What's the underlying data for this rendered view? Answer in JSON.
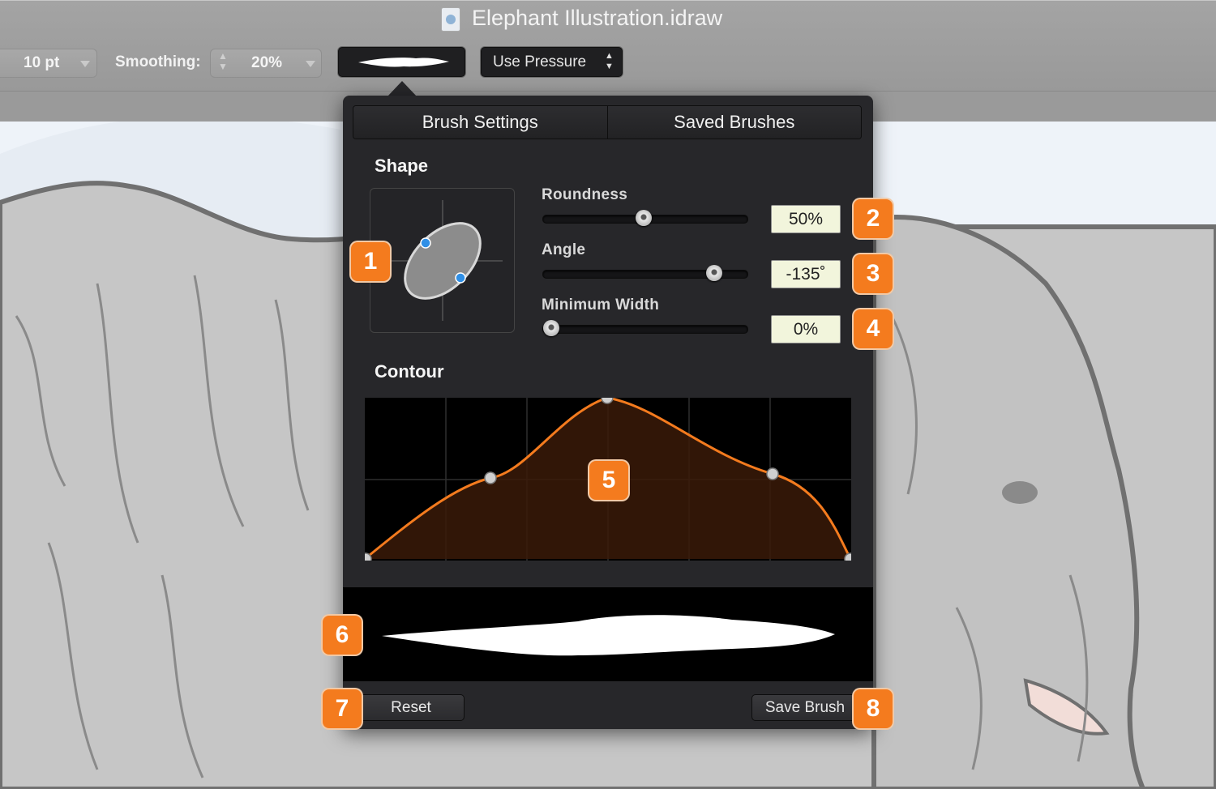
{
  "window": {
    "title": "Elephant Illustration.idraw"
  },
  "toolbar": {
    "size_value": "10 pt",
    "smoothing_label": "Smoothing:",
    "smoothing_value": "20%",
    "pressure_label": "Use Pressure"
  },
  "popover": {
    "tabs": [
      "Brush Settings",
      "Saved Brushes"
    ],
    "shape_heading": "Shape",
    "contour_heading": "Contour",
    "roundness": {
      "label": "Roundness",
      "value": "50%",
      "level": 0.5
    },
    "angle": {
      "label": "Angle",
      "value": "-135˚",
      "level": 0.84
    },
    "min_width": {
      "label": "Minimum Width",
      "value": "0%",
      "level": 0.0
    },
    "reset_label": "Reset",
    "save_label": "Save Brush"
  },
  "callouts": [
    "1",
    "2",
    "3",
    "4",
    "5",
    "6",
    "7",
    "8"
  ],
  "colors": {
    "accent": "#f47b1e",
    "contour_fill": "#3a1a08",
    "handle_blue": "#2f8fe6",
    "field_bg": "#f2f5dc"
  }
}
